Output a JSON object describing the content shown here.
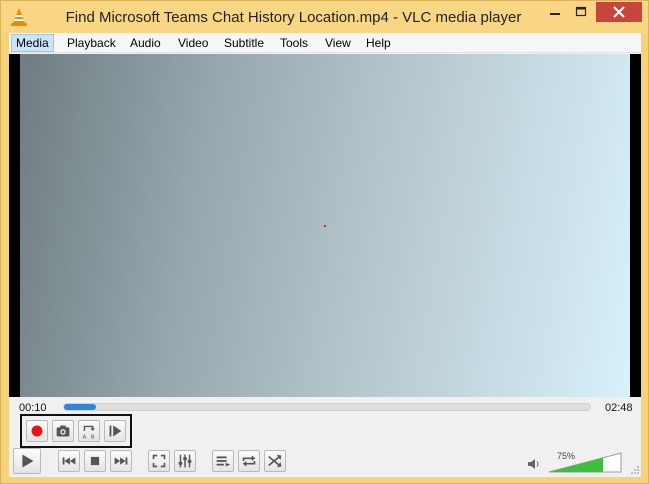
{
  "window": {
    "title": "Find Microsoft Teams Chat History Location.mp4 - VLC media player",
    "frame_color": "#f6d37a",
    "close_color": "#c7453a"
  },
  "menu": {
    "items": [
      "Media",
      "Playback",
      "Audio",
      "Video",
      "Subtitle",
      "Tools",
      "View",
      "Help"
    ]
  },
  "player": {
    "elapsed": "00:10",
    "total": "02:48",
    "progress_fraction": 0.06,
    "accent": "#2e86d6"
  },
  "advanced_controls": [
    "record-icon",
    "snapshot-icon",
    "loop-ab-icon",
    "frame-by-frame-icon"
  ],
  "main_controls": [
    "play-icon",
    "previous-icon",
    "stop-icon",
    "next-icon",
    "fullscreen-icon",
    "extended-settings-icon",
    "playlist-icon",
    "loop-icon",
    "random-icon"
  ],
  "volume": {
    "label": "75%",
    "level_fraction": 0.75,
    "color": "#3cbf3c"
  }
}
